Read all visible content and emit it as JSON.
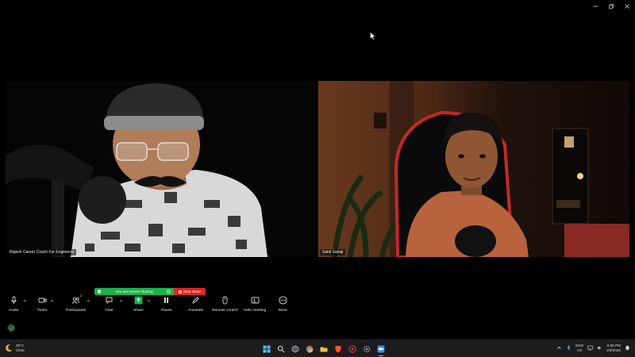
{
  "window": {
    "controls": [
      "minimize-icon",
      "restore-icon",
      "close-icon"
    ]
  },
  "participants": [
    {
      "name": "Rajesh Career Coach For Engineers"
    },
    {
      "name": "Sahil Sahaji"
    }
  ],
  "share_banner": {
    "text": "You are screen sharing",
    "stop_label": "Stop share"
  },
  "toolbar": {
    "audio": "Audio",
    "video": "Video",
    "participants": "Participants",
    "participants_count": "2",
    "chat": "Chat",
    "share": "Share",
    "pause": "Pause",
    "annotate": "Annotate",
    "remote_control": "Remote control",
    "hide_meeting": "Hide meeting",
    "more": "More"
  },
  "taskbar": {
    "weather_temp": "29°C",
    "weather_desc": "Clear",
    "apps": [
      "windows-start-icon",
      "search-icon",
      "app-icon",
      "chrome-icon",
      "file-explorer-icon",
      "brave-icon",
      "app-icon",
      "app-icon",
      "zoom-icon"
    ],
    "lang_line1": "ENG",
    "lang_line2": "US",
    "time": "6:50 PM",
    "date": "2/9/2025"
  },
  "colors": {
    "share_green": "#19b34a",
    "stop_red": "#e02424",
    "taskbar_bg": "#1c1c1f"
  }
}
